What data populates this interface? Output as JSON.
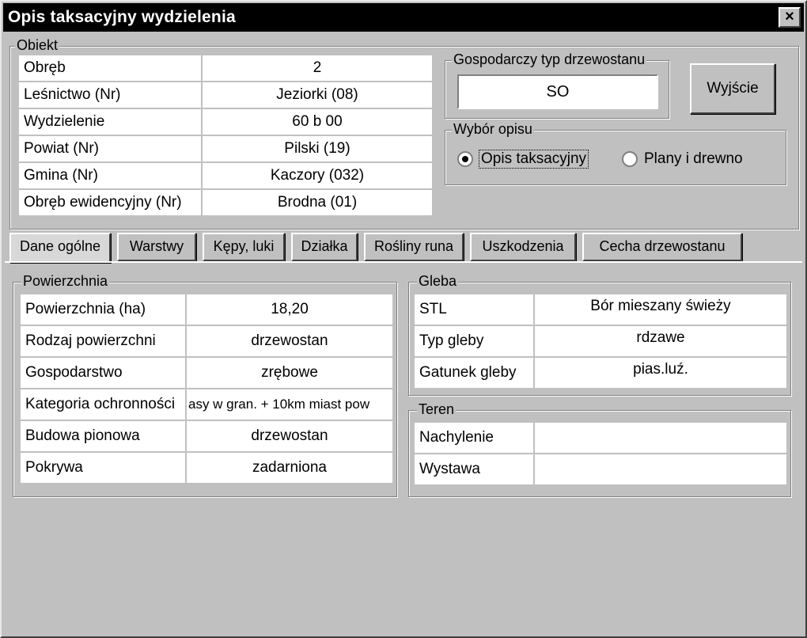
{
  "window": {
    "title": "Opis taksacyjny wydzielenia",
    "close_label": "×"
  },
  "obiekt": {
    "legend": "Obiekt",
    "rows": [
      {
        "label": "Obręb",
        "value": "2"
      },
      {
        "label": "Leśnictwo (Nr)",
        "value": "Jeziorki (08)"
      },
      {
        "label": "Wydzielenie",
        "value": "60  b  00"
      },
      {
        "label": "Powiat  (Nr)",
        "value": "Pilski (19)"
      },
      {
        "label": "Gmina (Nr)",
        "value": "Kaczory (032)"
      },
      {
        "label": "Obręb ewidencyjny  (Nr)",
        "value": "Brodna (01)"
      }
    ]
  },
  "gospodarczy": {
    "legend": "Gospodarczy typ drzewostanu",
    "value": "SO"
  },
  "exit_button": "Wyjście",
  "wybor": {
    "legend": "Wybór opisu",
    "options": [
      {
        "label": "Opis taksacyjny",
        "selected": true
      },
      {
        "label": "Plany i drewno",
        "selected": false
      }
    ]
  },
  "tabs": [
    {
      "label": "Dane ogólne",
      "active": true
    },
    {
      "label": "Warstwy",
      "active": false
    },
    {
      "label": "Kępy, luki",
      "active": false
    },
    {
      "label": "Działka",
      "active": false
    },
    {
      "label": "Rośliny runa",
      "active": false
    },
    {
      "label": "Uszkodzenia",
      "active": false
    },
    {
      "label": "Cecha drzewostanu",
      "active": false
    }
  ],
  "powierzchnia": {
    "legend": "Powierzchnia",
    "rows": [
      {
        "label": "Powierzchnia (ha)",
        "value": "18,20"
      },
      {
        "label": "Rodzaj powierzchni",
        "value": "drzewostan"
      },
      {
        "label": "Gospodarstwo",
        "value": "zrębowe"
      },
      {
        "label": "Kategoria ochronności",
        "value": "asy w gran. + 10km miast pow"
      },
      {
        "label": "Budowa pionowa",
        "value": "drzewostan"
      },
      {
        "label": "Pokrywa",
        "value": "zadarniona"
      }
    ]
  },
  "gleba": {
    "legend": "Gleba",
    "rows": [
      {
        "label": "STL",
        "value": "Bór mieszany świeży"
      },
      {
        "label": "Typ gleby",
        "value": "rdzawe"
      },
      {
        "label": "Gatunek gleby",
        "value": "pias.luź."
      }
    ]
  },
  "teren": {
    "legend": "Teren",
    "rows": [
      {
        "label": "Nachylenie",
        "value": ""
      },
      {
        "label": "Wystawa",
        "value": ""
      }
    ]
  }
}
